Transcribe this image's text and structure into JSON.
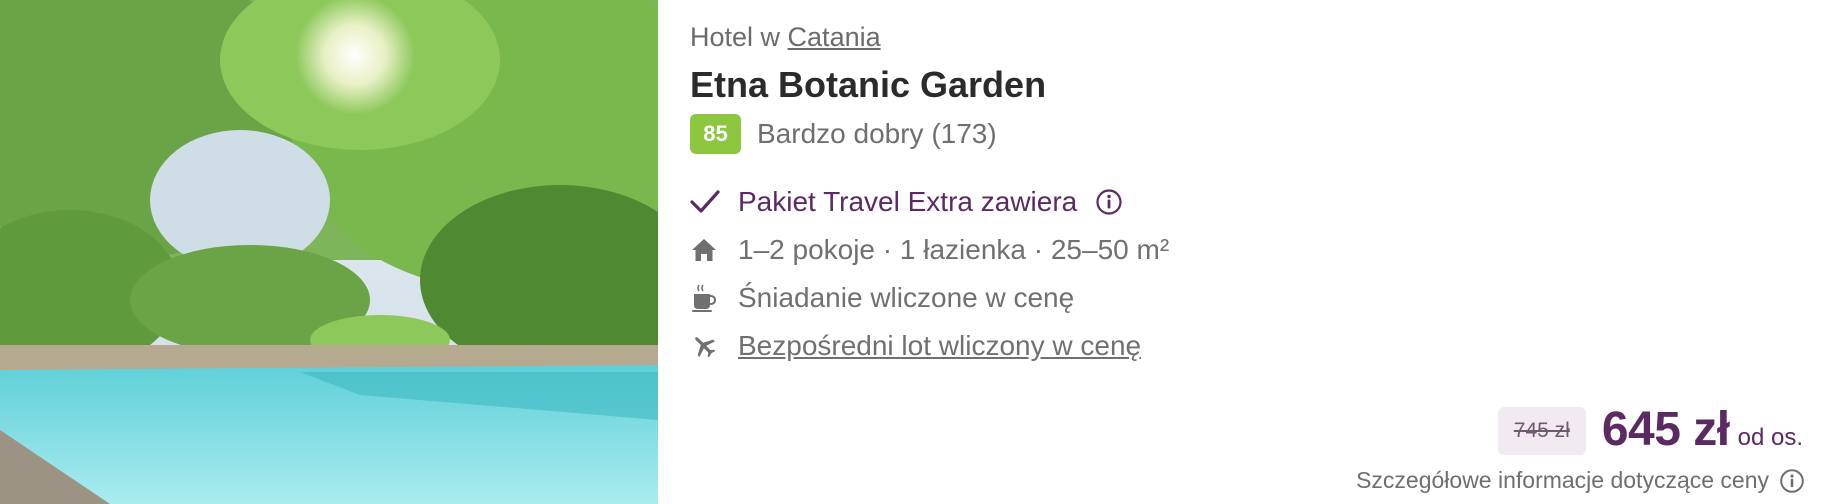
{
  "hotel": {
    "location_prefix": "Hotel w",
    "location_link": "Catania",
    "name": "Etna Botanic Garden",
    "rating_score": "85",
    "rating_label": "Bardzo dobry (173)"
  },
  "features": {
    "package": "Pakiet Travel Extra zawiera",
    "rooms": "1–2 pokoje · 1 łazienka · 25–50 m²",
    "breakfast": "Śniadanie wliczone w cenę",
    "flight": "Bezpośredni lot wliczony w cenę"
  },
  "price": {
    "old": "745 zł",
    "current": "645 zł",
    "per_person": "od os.",
    "details_link": "Szczegółowe informacje dotyczące ceny"
  },
  "icons": {
    "package": "checkmark-icon",
    "package_info": "info-icon",
    "rooms": "house-icon",
    "breakfast": "coffee-cup-icon",
    "flight": "airplane-icon",
    "price_info": "info-icon"
  },
  "colors": {
    "brand_purple": "#5b2a63",
    "rating_green": "#8dc63f",
    "old_price_bg": "#f1ebf1",
    "muted_text": "#6f6f6f"
  }
}
